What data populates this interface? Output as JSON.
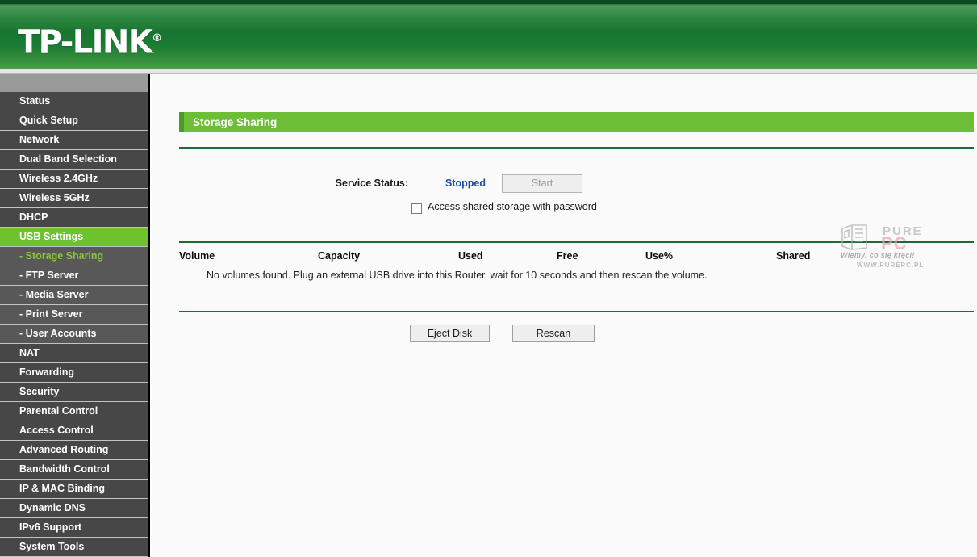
{
  "header": {
    "brand": "TP-LINK",
    "registered_mark": "®"
  },
  "sidebar": {
    "items": [
      {
        "label": "Status",
        "type": "top",
        "state": "normal"
      },
      {
        "label": "Quick Setup",
        "type": "top",
        "state": "normal"
      },
      {
        "label": "Network",
        "type": "top",
        "state": "normal"
      },
      {
        "label": "Dual Band Selection",
        "type": "top",
        "state": "normal"
      },
      {
        "label": "Wireless 2.4GHz",
        "type": "top",
        "state": "normal"
      },
      {
        "label": "Wireless 5GHz",
        "type": "top",
        "state": "normal"
      },
      {
        "label": "DHCP",
        "type": "top",
        "state": "normal"
      },
      {
        "label": "USB Settings",
        "type": "top",
        "state": "active"
      },
      {
        "label": "- Storage Sharing",
        "type": "sub",
        "state": "sub-active"
      },
      {
        "label": "- FTP Server",
        "type": "sub",
        "state": "normal"
      },
      {
        "label": "- Media Server",
        "type": "sub",
        "state": "normal"
      },
      {
        "label": "- Print Server",
        "type": "sub",
        "state": "normal"
      },
      {
        "label": "- User Accounts",
        "type": "sub",
        "state": "normal"
      },
      {
        "label": "NAT",
        "type": "top",
        "state": "normal"
      },
      {
        "label": "Forwarding",
        "type": "top",
        "state": "normal"
      },
      {
        "label": "Security",
        "type": "top",
        "state": "normal"
      },
      {
        "label": "Parental Control",
        "type": "top",
        "state": "normal"
      },
      {
        "label": "Access Control",
        "type": "top",
        "state": "normal"
      },
      {
        "label": "Advanced Routing",
        "type": "top",
        "state": "normal"
      },
      {
        "label": "Bandwidth Control",
        "type": "top",
        "state": "normal"
      },
      {
        "label": "IP & MAC Binding",
        "type": "top",
        "state": "normal"
      },
      {
        "label": "Dynamic DNS",
        "type": "top",
        "state": "normal"
      },
      {
        "label": "IPv6 Support",
        "type": "top",
        "state": "normal"
      },
      {
        "label": "System Tools",
        "type": "top",
        "state": "normal"
      }
    ]
  },
  "main": {
    "page_title": "Storage Sharing",
    "service_status_label": "Service Status:",
    "service_status_value": "Stopped",
    "start_button_label": "Start",
    "access_checkbox_label": "Access shared storage with password",
    "access_checkbox_checked": false,
    "table": {
      "columns": [
        "Volume",
        "Capacity",
        "Used",
        "Free",
        "Use%",
        "Shared"
      ],
      "rows": [],
      "empty_message": "No volumes found. Plug an external USB drive into this Router, wait for 10 seconds and then rescan the volume."
    },
    "eject_button_label": "Eject Disk",
    "rescan_button_label": "Rescan"
  },
  "watermark": {
    "word_pure": "PURE",
    "word_pc": "PC",
    "tagline": "Wiemy, co się kręci!",
    "site": "WWW.PUREPC.PL"
  },
  "colors": {
    "brand_green": "#1d7c33",
    "accent_green": "#6cbe36",
    "nav_active": "#6ec22c",
    "nav_sub_text": "#8cc63e",
    "status_blue": "#1f4fa0",
    "divider_green": "#1a6b3c"
  }
}
